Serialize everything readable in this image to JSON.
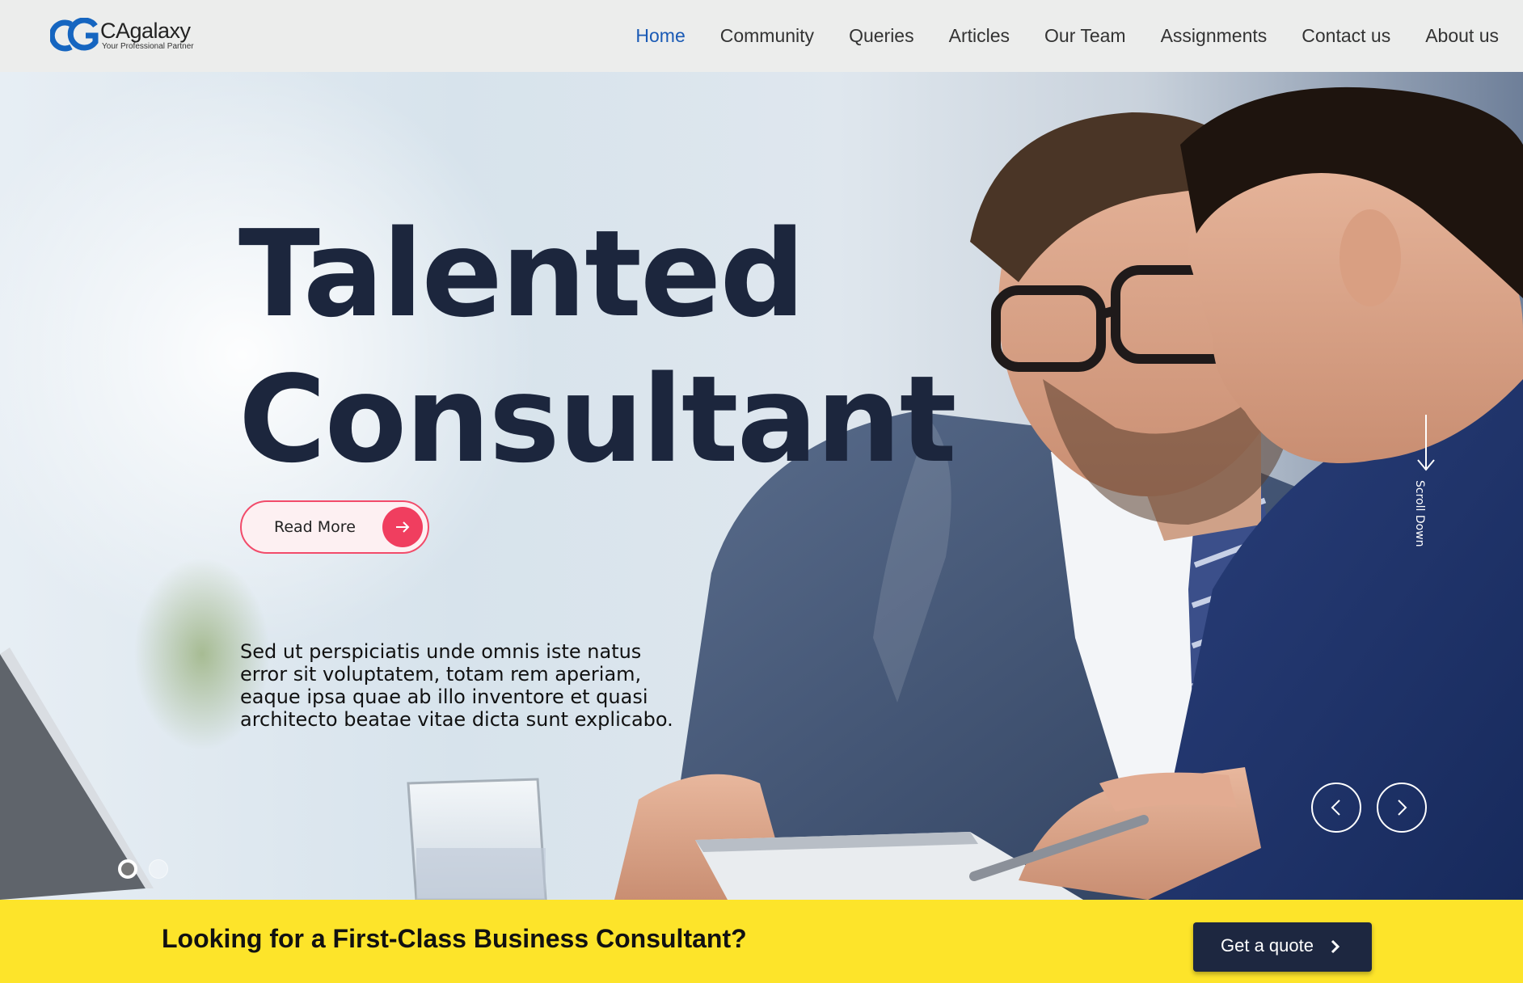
{
  "brand": {
    "name": "CAgalaxy",
    "tagline": "Your Professional Partner",
    "mark_letters": "CG",
    "colors": {
      "mark_blue": "#1565c0",
      "nav_active": "#1a5ab5"
    }
  },
  "nav": {
    "items": [
      {
        "label": "Home",
        "active": true
      },
      {
        "label": "Community"
      },
      {
        "label": "Queries"
      },
      {
        "label": "Articles"
      },
      {
        "label": "Our Team"
      },
      {
        "label": "Assignments"
      },
      {
        "label": "Contact us"
      },
      {
        "label": "About us"
      }
    ]
  },
  "hero": {
    "headline_line1": "Talented",
    "headline_line2": "Consultant",
    "read_more_label": "Read More",
    "read_more_icon": "arrow-right-icon",
    "description": "Sed ut perspiciatis unde omnis iste natus error sit voluptatem, totam rem aperiam, eaque ipsa quae ab illo inventore et quasi architecto beatae vitae dicta sunt explicabo.",
    "scroll_label": "Scroll Down",
    "prev_icon": "chevron-left-icon",
    "next_icon": "chevron-right-icon",
    "slides": {
      "count": 2,
      "active": 1
    },
    "colors": {
      "headline": "#1c263d",
      "accent": "#f03e5f"
    }
  },
  "cta": {
    "text": "Looking for a First-Class Business Consultant?",
    "button_label": "Get a quote",
    "button_icon": "chevron-right-icon",
    "colors": {
      "background": "#fde42a",
      "button": "#1d2740"
    }
  }
}
